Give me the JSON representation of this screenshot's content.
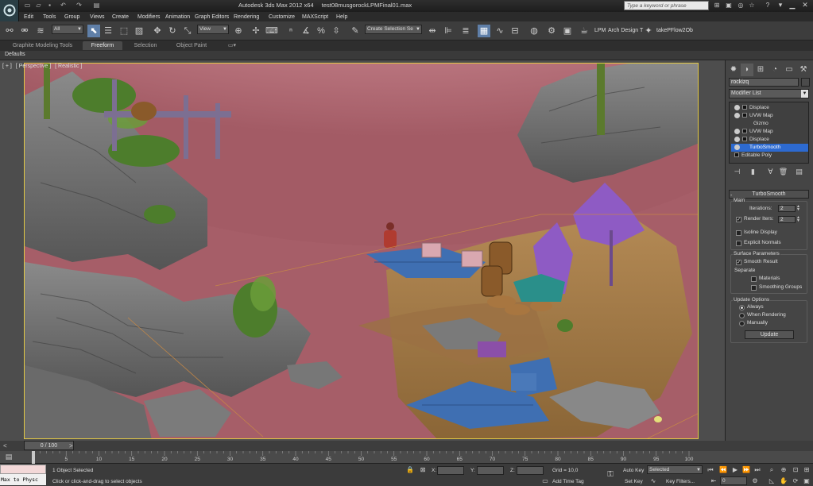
{
  "title_bar": {
    "app_title": "Autodesk 3ds Max  2012 x64",
    "file_name": "test08musgorockLPMFinal01.max",
    "search_placeholder": "Type a keyword or phrase"
  },
  "menu": [
    "Edit",
    "Tools",
    "Group",
    "Views",
    "Create",
    "Modifiers",
    "Animation",
    "Graph Editors",
    "Rendering",
    "Customize",
    "MAXScript",
    "Help"
  ],
  "toolbar": {
    "selection_filter": "All",
    "ref_coord": "View",
    "named_selection": "Create Selection Se",
    "lpm_label": "LPM",
    "arch_label": "Arch  Design T",
    "plugin_label": "takePFlow2Ob"
  },
  "ribbon_tabs": [
    "Graphite Modeling Tools",
    "Freeform",
    "Selection",
    "Object Paint"
  ],
  "ribbon_selected": "Freeform",
  "ribbon_defaults": "Defaults",
  "viewport": {
    "labels": [
      "[ + ]",
      "[ Perspective ]",
      "[ Realistic ]"
    ]
  },
  "command_panel": {
    "object_name": "rockizq",
    "modifier_list": "Modifier List",
    "stack": [
      {
        "label": "Displace",
        "eye": true,
        "selected": false,
        "indent": 0
      },
      {
        "label": "UVW Map",
        "eye": true,
        "selected": false,
        "indent": 0
      },
      {
        "label": "Gizmo",
        "eye": false,
        "selected": false,
        "indent": 1
      },
      {
        "label": "UVW Map",
        "eye": true,
        "selected": false,
        "indent": 0
      },
      {
        "label": "Displace",
        "eye": true,
        "selected": false,
        "indent": 0
      },
      {
        "label": "TurboSmooth",
        "eye": true,
        "selected": true,
        "indent": 0
      },
      {
        "label": "Editable Poly",
        "eye": false,
        "selected": false,
        "indent": 0
      }
    ],
    "turbosmooth": {
      "header": "TurboSmooth",
      "main_label": "Main",
      "iterations_label": "Iterations:",
      "iterations_value": "2",
      "render_iters_label": "Render Iters:",
      "render_iters_value": "2",
      "isoline_label": "Isoline Display",
      "explicit_normals_label": "Explicit Normals",
      "surface_params_label": "Surface Parameters",
      "smooth_result_label": "Smooth Result",
      "separate_label": "Separate",
      "materials_label": "Materials",
      "smoothing_groups_label": "Smoothing Groups",
      "update_options_label": "Update Options",
      "always_label": "Always",
      "when_rendering_label": "When Rendering",
      "manually_label": "Manually",
      "update_button": "Update"
    }
  },
  "timeline": {
    "slider_text": "0 / 100",
    "ticks": [
      "0",
      "5",
      "10",
      "15",
      "20",
      "25",
      "30",
      "35",
      "40",
      "45",
      "50",
      "55",
      "60",
      "65",
      "70",
      "75",
      "80",
      "85",
      "90",
      "95",
      "100"
    ],
    "current_frame": 0,
    "frame_range": [
      0,
      100
    ]
  },
  "status_bar": {
    "maxscript_text": "Max to Physc",
    "selection_info": "1 Object Selected",
    "prompt": "Click or click-and-drag to select objects",
    "x_label": "X:",
    "y_label": "Y:",
    "z_label": "Z:",
    "grid": "Grid = 10,0",
    "add_time_tag": "Add Time Tag",
    "auto_key": "Auto Key",
    "set_key": "Set Key",
    "key_mode": "Selected",
    "key_filters": "Key Filters...",
    "frame_field": "0"
  },
  "colors": {
    "viewport_border": "#e2c844",
    "selected_modifier": "#2d6ad0",
    "ground_pink": "#a65e68"
  }
}
